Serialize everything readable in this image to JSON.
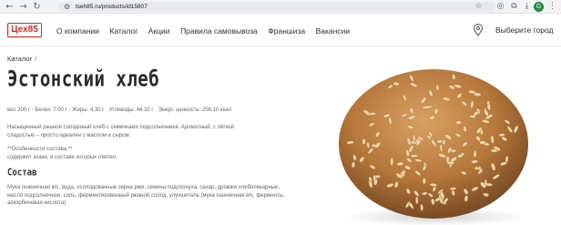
{
  "browser": {
    "url": "tseh85.ru/products/id15807",
    "profile_initial": "G"
  },
  "header": {
    "logo_text": "Цех85",
    "menu": [
      "О компании",
      "Каталог",
      "Акции",
      "Правила самовывоза",
      "Франшиза",
      "Вакансии"
    ],
    "city_label": "Выберите город"
  },
  "breadcrumb": {
    "label": "Каталог",
    "separator": "/"
  },
  "product": {
    "title": "Эстонский хлеб",
    "nutrition": "вес 200 г · Белки: 7.00 г · Жиры: 4.30 г · Углеводы: 44.10 г · Энерг. ценность: 256.10 ккал",
    "description": "Насыщенный ржаной солодовый хлеб с семечками подсолнечника. Ароматный, с лёгкой сладостью – просто идеален с маслом и сыром.",
    "features_heading": "**Особенности состава.**",
    "features_text": "содержит злаки, в составе которых глютен.",
    "composition_title": "Состав",
    "composition_text": "Мука пшеничная в/с, вода, осолодованные зерна ржи, семена подсолнуха, сахар, дрожжи хлебопекарные, масло подсолнечное, соль, ферментированный ржаной солод, улучшитель (мука пшеничная в/с, ферменты, аскорбиновая кислота)"
  },
  "colors": {
    "brand_red": "#d62b20",
    "text_dark": "#333333",
    "text_muted": "#666666"
  },
  "icons": {
    "back": "arrow-left-icon",
    "forward": "arrow-right-icon",
    "reload": "reload-icon",
    "site_info": "site-info-icon",
    "bookmark": "star-icon",
    "location": "map-pin-icon"
  }
}
